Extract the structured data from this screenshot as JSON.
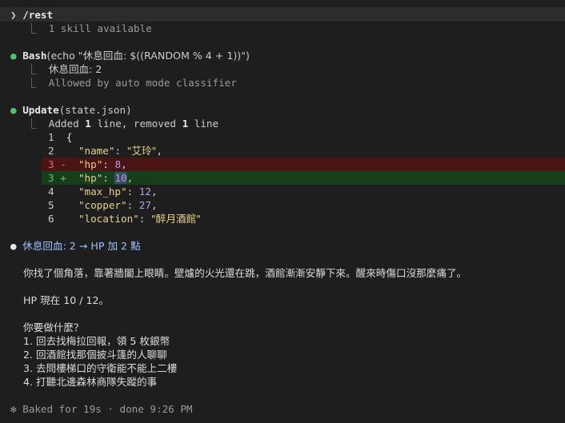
{
  "prompt": {
    "chevron": "❯",
    "command": "/rest",
    "result": "1 skill available"
  },
  "bash": {
    "tool": "Bash",
    "args": "(echo \"休息回血: $((RANDOM % 4 + 1))\")",
    "output": "休息回血: 2",
    "note": "Allowed by auto mode classifier"
  },
  "update": {
    "tool": "Update",
    "args": "(state.json)",
    "summary_prefix": "Added ",
    "added": "1",
    "summary_mid": " line, removed ",
    "removed": "1",
    "summary_suffix": " line",
    "lines": [
      {
        "n": "1",
        "mark": "",
        "text": "{"
      },
      {
        "n": "2",
        "mark": "",
        "key": "\"name\"",
        "value": "\"艾玲\"",
        "tail": ","
      },
      {
        "n": "3",
        "mark": "-",
        "key": "\"hp\"",
        "value": "8",
        "tail": ","
      },
      {
        "n": "3",
        "mark": "+",
        "key": "\"hp\"",
        "value": "10",
        "tail": ","
      },
      {
        "n": "4",
        "mark": "",
        "key": "\"max_hp\"",
        "value": "12",
        "tail": ","
      },
      {
        "n": "5",
        "mark": "",
        "key": "\"copper\"",
        "value": "27",
        "tail": ","
      },
      {
        "n": "6",
        "mark": "",
        "key": "\"location\"",
        "value": "\"醉月酒館\"",
        "tail": ""
      }
    ]
  },
  "message": {
    "headline": "休息回血: 2 → HP 加 2 點",
    "para1": "你找了個角落，靠著牆闔上眼睛。壁爐的火光還在跳，酒館漸漸安靜下來。醒來時傷口沒那麼痛了。",
    "para2": "HP 現在 10 / 12。",
    "question": "你要做什麼？",
    "options": [
      "1. 回去找梅拉回報，領 5 枚銀幣",
      "2. 回酒館找那個披斗篷的人聊聊",
      "3. 去問樓梯口的守衛能不能上二樓",
      "4. 打聽北邊森林商隊失蹤的事"
    ]
  },
  "footer": {
    "icon": "✻",
    "text": "Baked for 19s · done 9:26 PM"
  }
}
